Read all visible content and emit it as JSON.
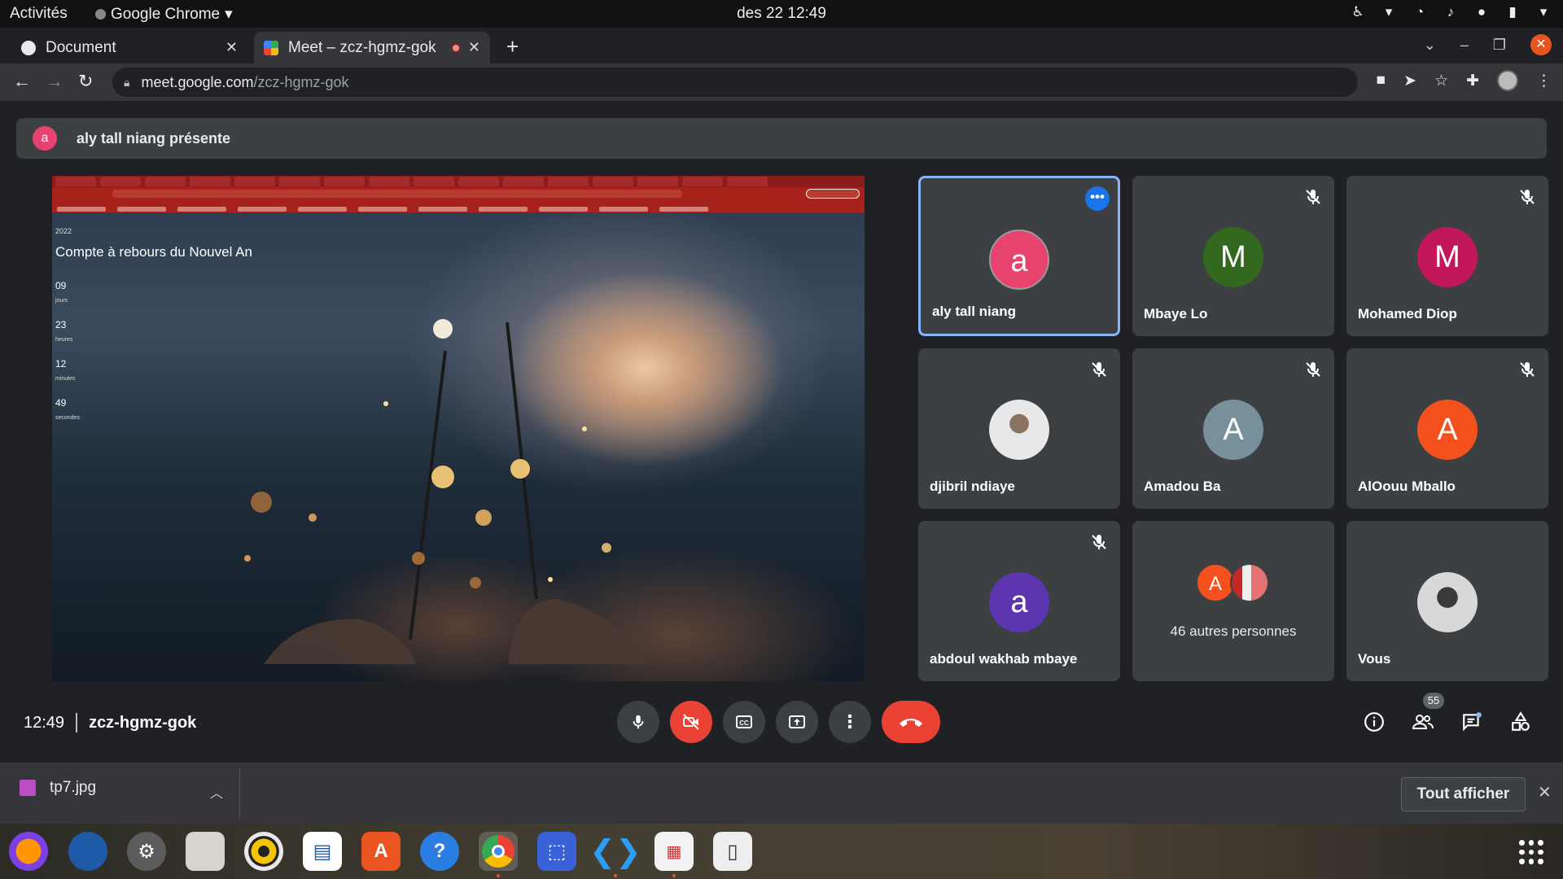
{
  "system_bar": {
    "activities": "Activités",
    "app_name": "Google Chrome",
    "clock": "des 22  12:49"
  },
  "browser": {
    "tabs": [
      {
        "title": "Document",
        "active": false
      },
      {
        "title": "Meet – zcz-hgmz-gok",
        "active": true
      }
    ],
    "url_host": "meet.google.com",
    "url_path": "/zcz-hgmz-gok"
  },
  "meet": {
    "presenting_banner": {
      "avatar_letter": "a",
      "text": "aly tall niang présente"
    },
    "shared_screen": {
      "year": "2022",
      "heading": "Compte à rebours du Nouvel An",
      "countdown": [
        {
          "value": "09",
          "unit": "jours"
        },
        {
          "value": "23",
          "unit": "heures"
        },
        {
          "value": "12",
          "unit": "minutes"
        },
        {
          "value": "49",
          "unit": "secondes"
        }
      ]
    },
    "participants": [
      {
        "name": "aly tall niang",
        "letter": "a",
        "color": "#e8436f",
        "speaking": true,
        "muted": false
      },
      {
        "name": "Mbaye Lo",
        "letter": "M",
        "color": "#33691e",
        "muted": true
      },
      {
        "name": "Mohamed Diop",
        "letter": "M",
        "color": "#c2185b",
        "muted": true
      },
      {
        "name": "djibril ndiaye",
        "letter": "",
        "photo": true,
        "muted": true
      },
      {
        "name": "Amadou Ba",
        "letter": "A",
        "color": "#78909c",
        "muted": true
      },
      {
        "name": "AlOouu Mballo",
        "letter": "A",
        "color": "#f4511e",
        "muted": true
      },
      {
        "name": "abdoul wakhab mbaye",
        "letter": "a",
        "color": "#5e35b1",
        "muted": true
      },
      {
        "name": "",
        "others_label": "46 autres personnes",
        "letter": "A",
        "color": "#f4511e"
      },
      {
        "name": "Vous",
        "letter": "",
        "photo": true
      }
    ],
    "controls": {
      "time": "12:49",
      "meeting_code": "zcz-hgmz-gok",
      "people_count": "55"
    }
  },
  "downloads": {
    "file_name": "tp7.jpg",
    "show_all_label": "Tout afficher"
  }
}
